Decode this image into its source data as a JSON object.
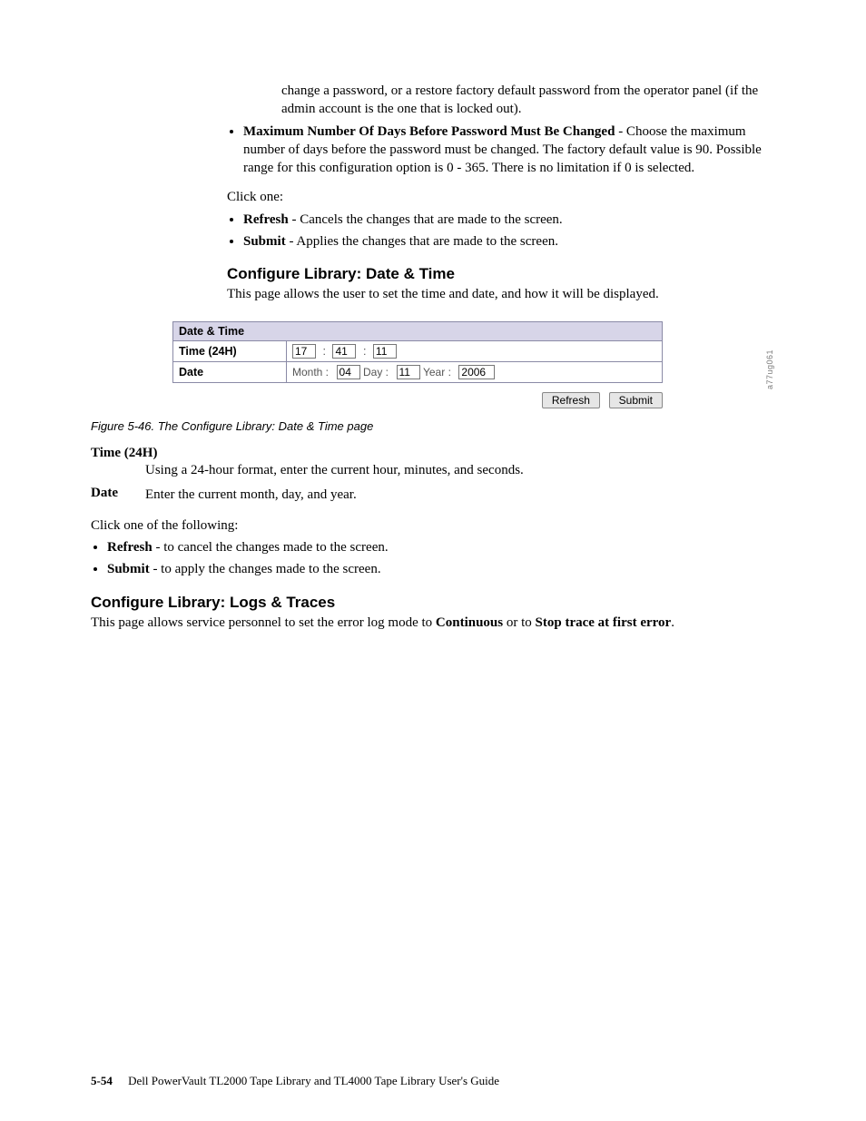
{
  "intro": {
    "lead_in": "change a password, or a restore factory default password from the operator panel (if the admin account is the one that is locked out).",
    "bullet1_term": "Maximum Number Of Days Before Password Must Be Changed",
    "bullet1_rest": " - Choose the maximum number of days before the password must be changed. The factory default value is 90. Possible range for this configuration option is 0 - 365. There is no limitation if 0 is selected.",
    "click_one": "Click one:",
    "refresh_term": "Refresh",
    "refresh_rest": " - Cancels the changes that are made to the screen.",
    "submit_term": "Submit",
    "submit_rest": " - Applies the changes that are made to the screen."
  },
  "datetime_section": {
    "heading": "Configure Library: Date & Time",
    "desc": "This page allows the user to set the time and date, and how it will be displayed.",
    "table_header": "Date & Time",
    "row_time_label": "Time (24H)",
    "row_date_label": "Date",
    "time_h": "17",
    "time_m": "41",
    "time_s": "11",
    "colon": ":",
    "month_label": "Month :",
    "day_label": "Day :",
    "year_label": "Year :",
    "month_val": "04",
    "day_val": "11",
    "year_val": "2006",
    "refresh_btn": "Refresh",
    "submit_btn": "Submit",
    "side_code": "a77ug061",
    "figure_caption": "Figure 5-46. The Configure Library: Date & Time page",
    "def_time_term": "Time (24H)",
    "def_time_desc": "Using a 24-hour format, enter the current hour, minutes, and seconds.",
    "def_date_term": "Date",
    "def_date_desc": "Enter the current month, day, and year.",
    "click_following": "Click one of the following:",
    "b_refresh_term": "Refresh",
    "b_refresh_rest": " - to cancel the changes made to the screen.",
    "b_submit_term": "Submit",
    "b_submit_rest": " - to apply the changes made to the screen."
  },
  "logs_section": {
    "heading": "Configure Library: Logs & Traces",
    "desc_pre": "This page allows service personnel to set the error log mode to ",
    "desc_bold1": "Continuous",
    "desc_mid": " or to ",
    "desc_bold2": "Stop trace at first error",
    "desc_tail": "."
  },
  "footer": {
    "page_num": "5-54",
    "title": "Dell PowerVault TL2000 Tape Library and TL4000 Tape Library User's Guide"
  }
}
